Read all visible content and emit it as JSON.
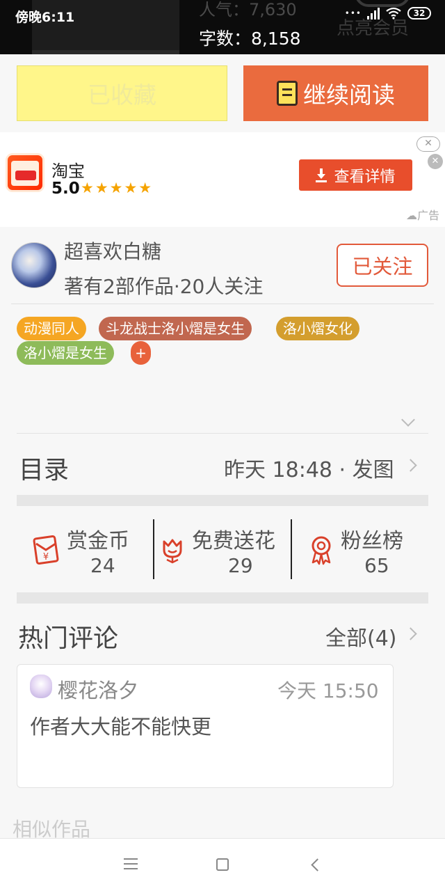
{
  "status_bar": {
    "time": "傍晚6:11",
    "battery": "32"
  },
  "header": {
    "popularity": "人气：7,630",
    "word_count": "字数：8,158",
    "member": "点亮会员"
  },
  "actions": {
    "collected_label": "已收藏",
    "continue_label": "继续阅读"
  },
  "ad": {
    "app_name": "淘宝",
    "rating": "5.0",
    "stars": "★★★★★",
    "button_label": "查看详情",
    "close_glyph": "✕",
    "label": "广告"
  },
  "author": {
    "name": "超喜欢白糖",
    "info": "著有2部作品·20人关注",
    "follow_label": "已关注"
  },
  "tags": [
    {
      "label": "动漫同人",
      "color": "#f5a623"
    },
    {
      "label": "斗龙战士洛小熠是女生",
      "color": "#c1674f"
    },
    {
      "label": "洛小熠女化",
      "color": "#d49e2e"
    },
    {
      "label": "洛小熠是女生",
      "color": "#8ebb5a"
    },
    {
      "label": "+",
      "color": "#e8623b"
    }
  ],
  "catalog": {
    "title": "目录",
    "update": "昨天 18:48 · 发图"
  },
  "stats": [
    {
      "label": "赏金币",
      "value": "24",
      "icon": "red-envelope-icon"
    },
    {
      "label": "免费送花",
      "value": "29",
      "icon": "flower-icon"
    },
    {
      "label": "粉丝榜",
      "value": "65",
      "icon": "medal-icon"
    }
  ],
  "comments": {
    "title": "热门评论",
    "all_label": "全部(4)",
    "items": [
      {
        "user": "樱花洛夕",
        "time": "今天 15:50",
        "text": "作者大大能不能快更"
      }
    ]
  },
  "similar": {
    "title": "相似作品"
  },
  "colors": {
    "accent": "#ea6b3e",
    "collected_bg": "#fff68a",
    "icon_red": "#d9402a"
  }
}
